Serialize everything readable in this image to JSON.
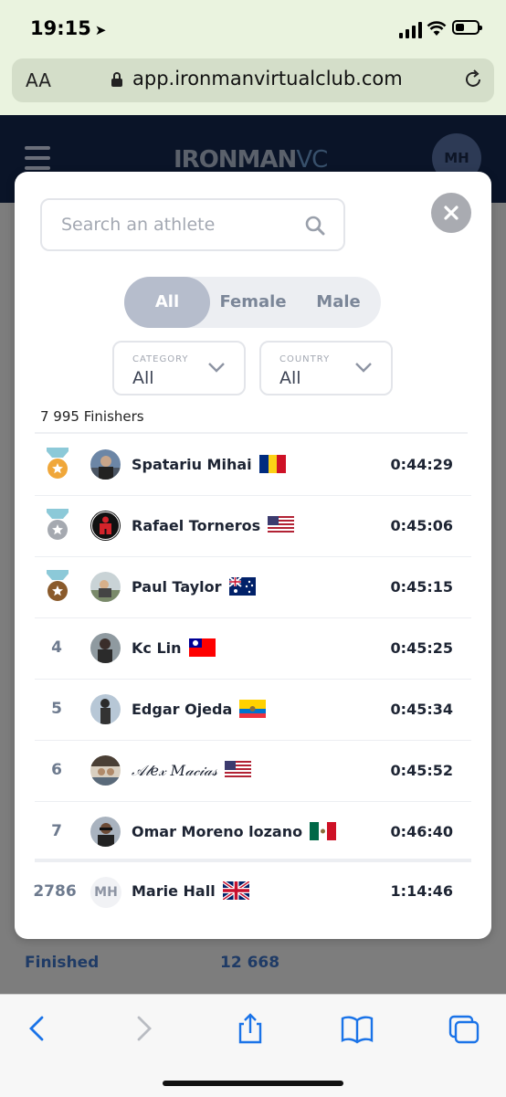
{
  "status_bar": {
    "time": "19:15"
  },
  "browser": {
    "text_size_label": "AA",
    "url": "app.ironmanvirtualclub.com"
  },
  "site": {
    "logo": "IRONMAN",
    "logo_suffix": "VC",
    "user_initials": "MH",
    "finished_label": "Finished",
    "finished_count": "12 668"
  },
  "modal": {
    "search_placeholder": "Search an athlete",
    "gender_filter": {
      "options": [
        "All",
        "Female",
        "Male"
      ],
      "selected": "All"
    },
    "category": {
      "label": "CATEGORY",
      "value": "All"
    },
    "country": {
      "label": "COUNTRY",
      "value": "All"
    },
    "finishers_text": "7 995 Finishers",
    "rows": [
      {
        "rank": "1",
        "medal": "gold",
        "name": "Spatariu Mihai",
        "flag": "Romania",
        "time": "0:44:29"
      },
      {
        "rank": "2",
        "medal": "silver",
        "name": "Rafael Torneros",
        "flag": "United States",
        "time": "0:45:06"
      },
      {
        "rank": "3",
        "medal": "bronze",
        "name": "Paul Taylor",
        "flag": "Australia",
        "time": "0:45:15"
      },
      {
        "rank": "4",
        "name": "Kc Lin",
        "flag": "Taiwan",
        "time": "0:45:25"
      },
      {
        "rank": "5",
        "name": "Edgar Ojeda",
        "flag": "Ecuador",
        "time": "0:45:34"
      },
      {
        "rank": "6",
        "name": "𝒜𝓁𝑒𝓍 𝑀𝒶𝒸𝒾𝒶𝓈",
        "flag": "United States",
        "time": "0:45:52"
      },
      {
        "rank": "7",
        "name": "Omar Moreno lozano",
        "flag": "Mexico",
        "time": "0:46:40"
      }
    ],
    "current_user": {
      "rank": "2786",
      "initials": "MH",
      "name": "Marie Hall",
      "flag": "United Kingdom",
      "time": "1:14:46"
    }
  },
  "colors": {
    "gold": "#f0a73a",
    "silver": "#a5a9b0",
    "bronze": "#8a5a2b",
    "ribbon": "#8cc9d8",
    "accent": "#b6bdcc"
  }
}
